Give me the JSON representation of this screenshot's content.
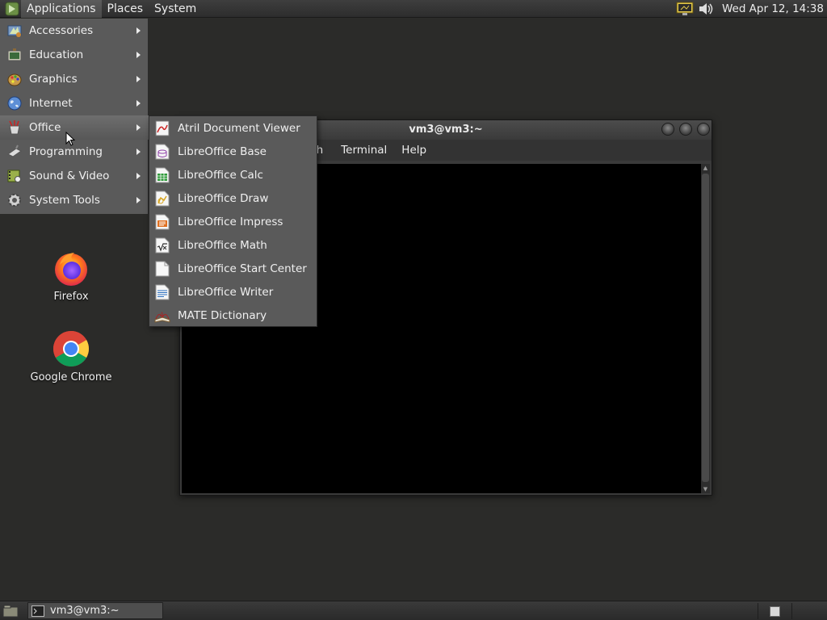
{
  "top_panel": {
    "menus": [
      {
        "label": "Applications"
      },
      {
        "label": "Places"
      },
      {
        "label": "System"
      }
    ],
    "clock": "Wed Apr 12, 14:38"
  },
  "app_menu": {
    "items": [
      {
        "label": "Accessories",
        "icon": "accessories-icon"
      },
      {
        "label": "Education",
        "icon": "education-icon"
      },
      {
        "label": "Graphics",
        "icon": "graphics-icon"
      },
      {
        "label": "Internet",
        "icon": "internet-globe-icon"
      },
      {
        "label": "Office",
        "icon": "office-icon",
        "active": true
      },
      {
        "label": "Programming",
        "icon": "programming-icon"
      },
      {
        "label": "Sound & Video",
        "icon": "sound-video-icon"
      },
      {
        "label": "System Tools",
        "icon": "system-tools-gear-icon"
      }
    ]
  },
  "office_menu": {
    "items": [
      {
        "label": "Atril Document Viewer",
        "icon": "atril-icon"
      },
      {
        "label": "LibreOffice Base",
        "icon": "libreoffice-base-icon"
      },
      {
        "label": "LibreOffice Calc",
        "icon": "libreoffice-calc-icon"
      },
      {
        "label": "LibreOffice Draw",
        "icon": "libreoffice-draw-icon"
      },
      {
        "label": "LibreOffice Impress",
        "icon": "libreoffice-impress-icon"
      },
      {
        "label": "LibreOffice Math",
        "icon": "libreoffice-math-icon"
      },
      {
        "label": "LibreOffice Start Center",
        "icon": "libreoffice-start-center-icon"
      },
      {
        "label": "LibreOffice Writer",
        "icon": "libreoffice-writer-icon"
      },
      {
        "label": "MATE Dictionary",
        "icon": "dictionary-icon"
      }
    ]
  },
  "desktop_icons": [
    {
      "label": "Firefox",
      "icon": "firefox-icon"
    },
    {
      "label": "Google Chrome",
      "icon": "chrome-icon"
    }
  ],
  "terminal_window": {
    "title": "vm3@vm3:~",
    "menus": [
      {
        "label": "rch"
      },
      {
        "label": "Terminal"
      },
      {
        "label": "Help"
      }
    ]
  },
  "bottom_panel": {
    "task_label": "vm3@vm3:~"
  },
  "colors": {
    "desktop": "#2b2b29",
    "menu_bg": "#5a5a5a",
    "terminal_bg": "#000000"
  }
}
